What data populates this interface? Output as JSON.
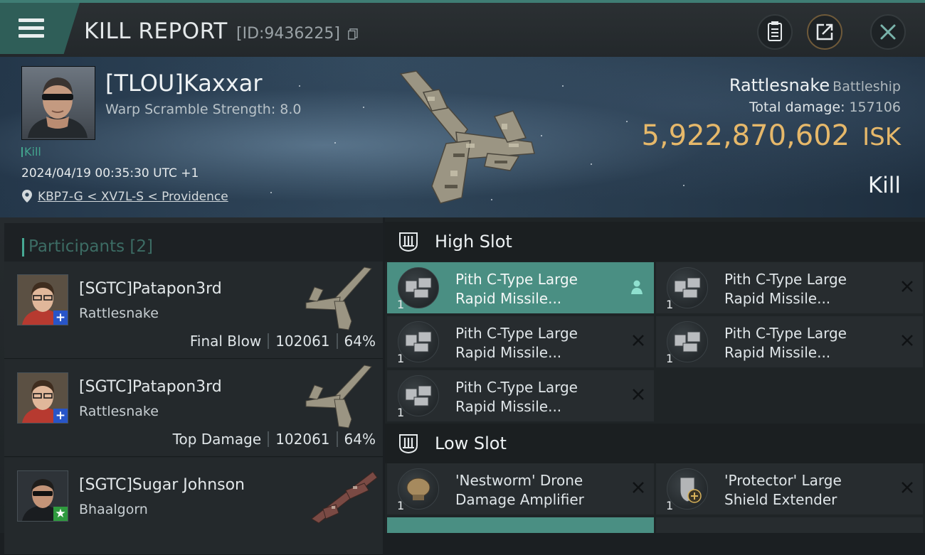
{
  "window": {
    "title": "KILL REPORT",
    "report_id": "[ID:9436225]",
    "accent": "#3f7d74",
    "icons": [
      "hamburger-icon",
      "copy-icon",
      "clipboard-icon",
      "share-icon",
      "close-icon"
    ]
  },
  "victim": {
    "name": "[TLOU]Kaxxar",
    "warp_scramble": "Warp Scramble Strength: 8.0",
    "tag": "Kill",
    "datetime": "2024/04/19 00:35:30 UTC +1",
    "location": "KBP7-G < XV7L-S < Providence",
    "ship": "Rattlesnake",
    "ship_class": "Battleship",
    "total_damage_label": "Total damage:",
    "total_damage": "157106",
    "isk_value": "5,922,870,602",
    "isk_unit": "ISK",
    "result": "Kill",
    "isk_color": "#e6b86a"
  },
  "participants": {
    "title": "Participants [2]",
    "rows": [
      {
        "name": "[SGTC]Patapon3rd",
        "ship": "Rattlesnake",
        "role": "Final Blow",
        "damage": "102061",
        "percent": "64%",
        "badge": "+"
      },
      {
        "name": "[SGTC]Patapon3rd",
        "ship": "Rattlesnake",
        "role": "Top Damage",
        "damage": "102061",
        "percent": "64%",
        "badge": "+"
      },
      {
        "name": "[SGTC]Sugar Johnson",
        "ship": "Bhaalgorn",
        "role": "",
        "damage": "",
        "percent": "",
        "badge": "★"
      }
    ]
  },
  "fittings": {
    "high_slot": {
      "title": "High Slot",
      "modules": [
        {
          "qty": "1",
          "line1": "Pith C-Type Large",
          "line2": "Rapid Missile...",
          "selected": true
        },
        {
          "qty": "1",
          "line1": "Pith C-Type Large",
          "line2": "Rapid Missile...",
          "selected": false
        },
        {
          "qty": "1",
          "line1": "Pith C-Type Large",
          "line2": "Rapid Missile...",
          "selected": false
        },
        {
          "qty": "1",
          "line1": "Pith C-Type Large",
          "line2": "Rapid Missile...",
          "selected": false
        },
        {
          "qty": "1",
          "line1": "Pith C-Type Large",
          "line2": "Rapid Missile...",
          "selected": false
        }
      ]
    },
    "low_slot": {
      "title": "Low Slot",
      "modules": [
        {
          "qty": "1",
          "line1": "'Nestworm' Drone",
          "line2": "Damage Amplifier",
          "selected": false
        },
        {
          "qty": "1",
          "line1": "'Protector' Large",
          "line2": "Shield Extender",
          "selected": false
        }
      ]
    }
  }
}
